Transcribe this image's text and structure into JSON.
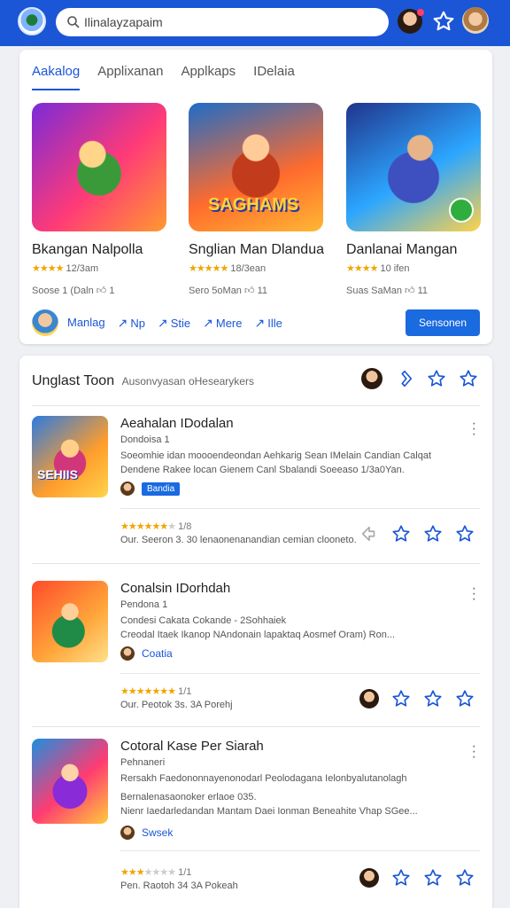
{
  "colors": {
    "brand": "#1a56d6",
    "accent_button": "#1a6ae0",
    "star": "#f0a500"
  },
  "search": {
    "value": "Ilinalayzapaim",
    "icon": "search-icon"
  },
  "header": {
    "icons": [
      "app-logo",
      "user-avatar",
      "star-icon",
      "profile-avatar"
    ]
  },
  "tabs": [
    {
      "label": "Aakalog",
      "active": true
    },
    {
      "label": "Applixanan"
    },
    {
      "label": "Applkaps"
    },
    {
      "label": "IDelaia"
    }
  ],
  "featured": [
    {
      "name": "Bkangan Nalpolla",
      "stars": "★★★★",
      "rating_text": "12/3am",
      "meta_left": "Soose 1 (Daln",
      "meta_right": "1"
    },
    {
      "name": "Snglian Man Dlandua",
      "stars": "★★★★★",
      "rating_text": "18/3ean",
      "meta_left": "Sero 5oMan",
      "meta_right": "11",
      "logo_text": "SAGHAMS"
    },
    {
      "name": "Danlanai Mangan",
      "stars": "★★★★",
      "rating_text": "10 ifen",
      "meta_left": "Suas SaMan",
      "meta_right": "11"
    }
  ],
  "featured_footer": {
    "links": [
      "Manlag",
      "Np",
      "Stie",
      "Mere",
      "Ille"
    ],
    "button": "Sensonen"
  },
  "section": {
    "title": "Unglast Toon",
    "subtitle": "Ausonvyasan oHesearykers"
  },
  "rows": [
    {
      "title": "Aeahalan IDodalan",
      "line2": "Dondoisa 1",
      "desc": [
        "Soeomhie idan moooendeondan Aehkarig Sean IMelain Candian Calqat",
        "Dendene Rakee locan Gienem Canl Sbalandi Soeeaso 1/3a0Yan."
      ],
      "tag": "Bandia",
      "tag_pill": true,
      "icon_label": "SEHIIS",
      "stars_on": "★★★★★★",
      "stars_off": "★",
      "rating_count": "1/8",
      "info": "Our. Seeron 3. 30 lenaonenanandian cemian clooneto."
    },
    {
      "title": "Conalsin IDorhdah",
      "line2": "Pendona 1",
      "desc": [
        "Condesi Cakata Cokande - 2Sohhaiek",
        "Creodal Itaek Ikanop NAndonain lapaktaq Aosmef Oram) Ron..."
      ],
      "tag": "Coatia",
      "tag_pill": false,
      "stars_on": "★★★★★★★",
      "stars_off": "",
      "rating_count": "1/1",
      "info": "Our. Peotok 3s. 3A Porehj"
    },
    {
      "title": "Cotoral Kase Per Siarah",
      "line2": "Pehnaneri",
      "desc": [
        "Rersakh Faedononnayenonodarl Peolodagana Ielonbyalutanolagh",
        "Bernalenasaonoker erlaoe 035.",
        "Nienr Iaedarledandan Mantam Daei Ionman Beneahite Vhap SGee..."
      ],
      "tag": "Swsek",
      "tag_pill": false,
      "stars_on": "★★★",
      "stars_off": "★★★★",
      "rating_count": "1/1",
      "info": "Pen. Raotoh 34 3A Pokeah"
    }
  ]
}
